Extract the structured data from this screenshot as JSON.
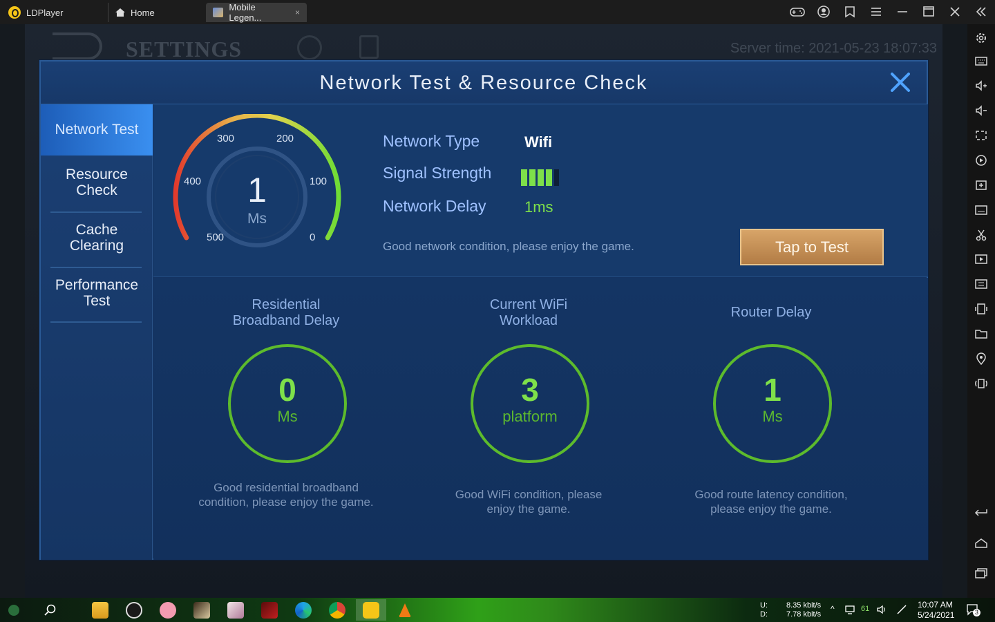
{
  "titlebar": {
    "app_name": "LDPlayer",
    "tabs": [
      {
        "label": "Home"
      },
      {
        "label": "Mobile Legen..."
      }
    ],
    "close_tab": "×"
  },
  "background": {
    "settings_label": "SETTINGS",
    "server_time": "Server time: 2021-05-23 18:07:33"
  },
  "dialog": {
    "title": "Network Test & Resource Check",
    "sidebar": [
      {
        "label": "Network Test"
      },
      {
        "label": "Resource Check"
      },
      {
        "label": "Cache Clearing"
      },
      {
        "label": "Performance Test"
      }
    ],
    "gauge": {
      "value": "1",
      "unit": "Ms",
      "ticks": [
        "500",
        "400",
        "300",
        "200",
        "100",
        "0"
      ],
      "level_fraction": 0.0
    },
    "info": {
      "network_type_label": "Network Type",
      "network_type_value": "Wifi",
      "signal_label": "Signal Strength",
      "signal_bars": 4,
      "signal_bars_total": 5,
      "delay_label": "Network Delay",
      "delay_value": "1ms",
      "condition": "Good network condition, please enjoy the game.",
      "tap_button": "Tap to Test"
    },
    "metrics": [
      {
        "title_line1": "Residential",
        "title_line2": "Broadband Delay",
        "value": "0",
        "unit": "Ms",
        "desc": "Good residential broadband condition, please enjoy the game."
      },
      {
        "title_line1": "Current WiFi",
        "title_line2": "Workload",
        "value": "3",
        "unit": "platform",
        "desc": "Good WiFi condition, please enjoy the game."
      },
      {
        "title_line1": "Router Delay",
        "title_line2": "",
        "value": "1",
        "unit": "Ms",
        "desc": "Good route latency condition, please enjoy the game."
      }
    ]
  },
  "taskbar": {
    "upload_label": "U:",
    "download_label": "D:",
    "upload_rate": "8.35 kbit/s",
    "download_rate": "7.78 kbit/s",
    "battery": "61",
    "time": "10:07 AM",
    "date": "5/24/2021",
    "notifications": "3"
  },
  "colors": {
    "dialog_bg": "#143362",
    "accent_green": "#7ee04a",
    "label_blue": "#9fc1ff",
    "tap_button": "#c68f55",
    "close_x": "#4fa3ff"
  }
}
